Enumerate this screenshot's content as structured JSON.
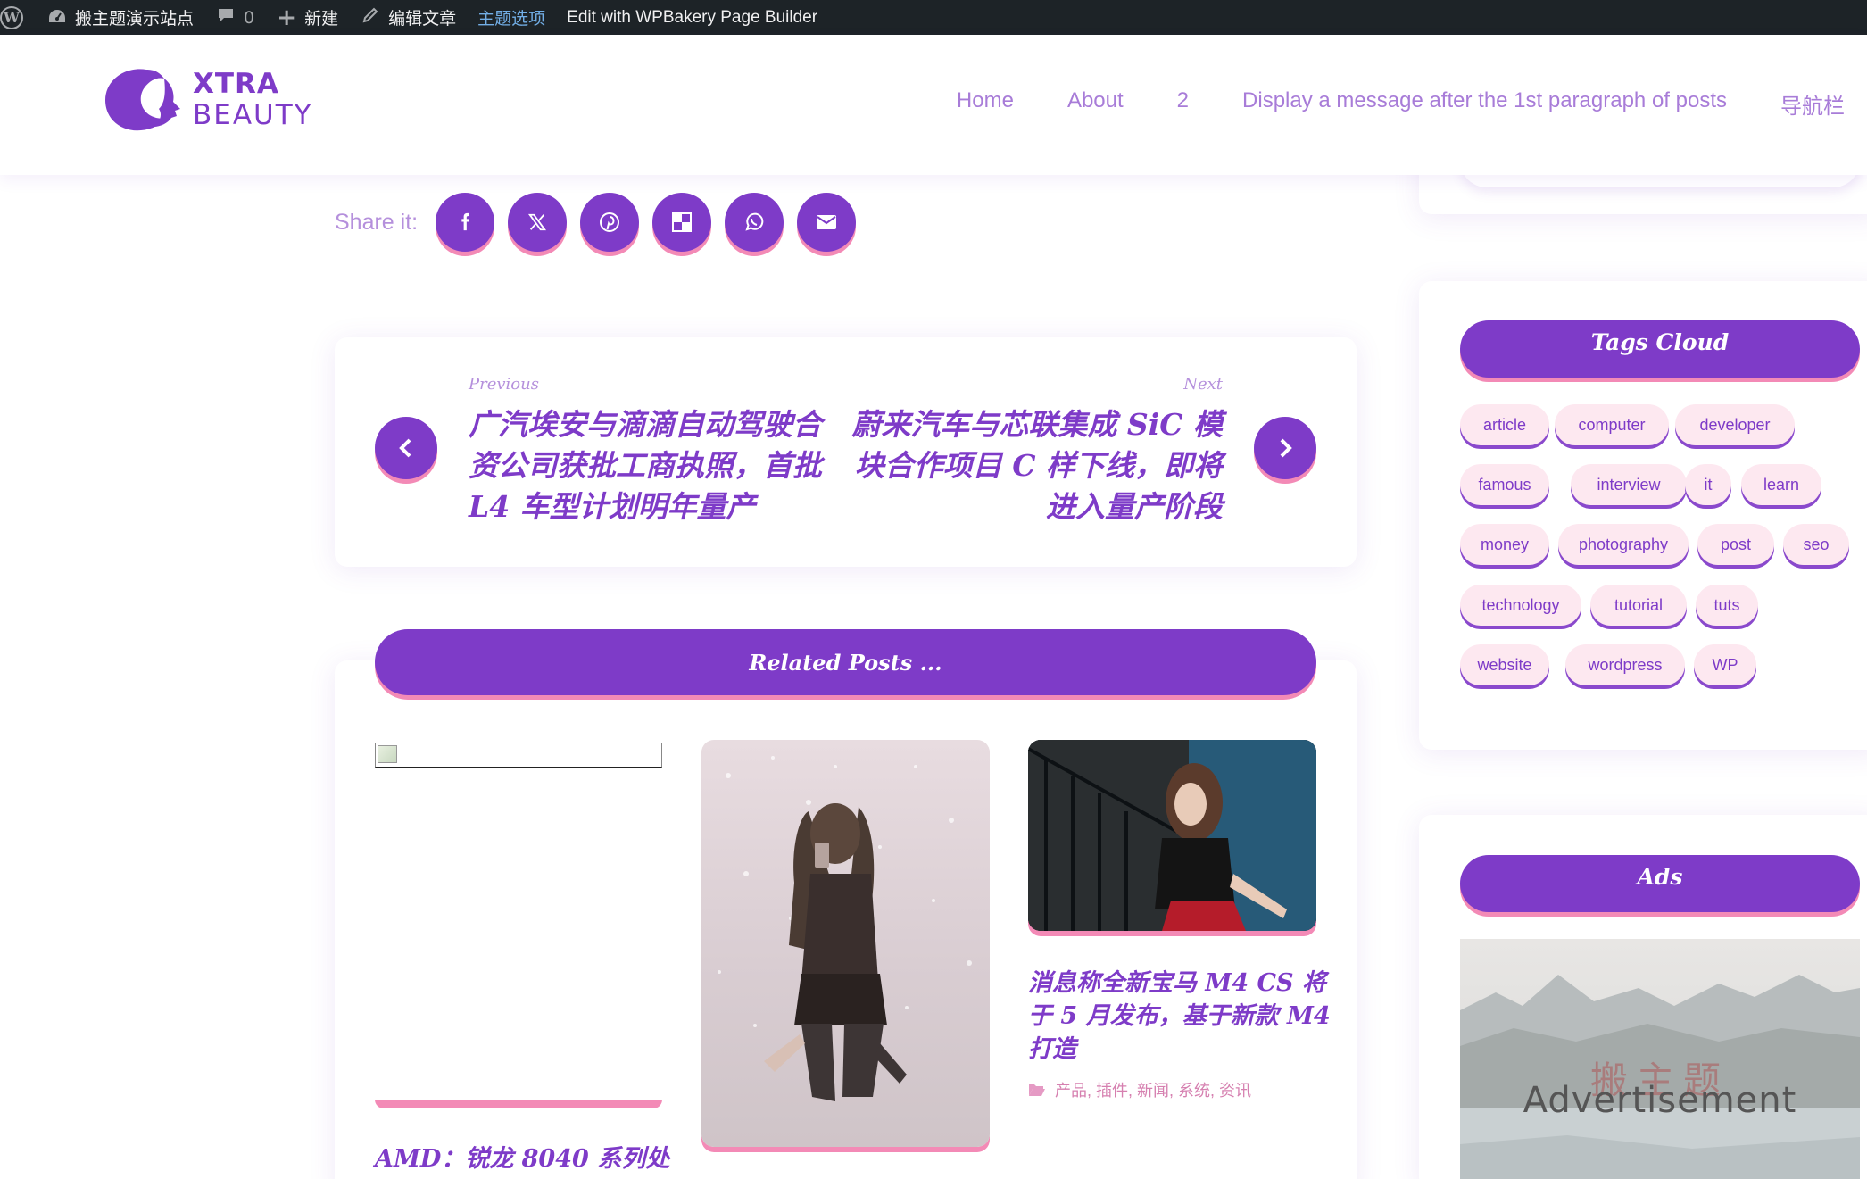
{
  "adminbar": {
    "site_name": "搬主题演示站点",
    "comments_count": "0",
    "new_label": "新建",
    "edit_label": "编辑文章",
    "theme_options_label": "主题选项",
    "wpbakery_label": "Edit with WPBakery Page Builder"
  },
  "logo": {
    "line1": "XTRA",
    "line2": "BEAUTY"
  },
  "nav": {
    "items": [
      {
        "label": "Home"
      },
      {
        "label": "About"
      },
      {
        "label": "2"
      },
      {
        "label": "Display a message after the 1st paragraph of posts"
      },
      {
        "label": "导航栏"
      }
    ]
  },
  "share": {
    "label": "Share it:",
    "buttons": [
      "facebook-icon",
      "x-icon",
      "pinterest-icon",
      "delicious-icon",
      "whatsapp-icon",
      "email-icon"
    ]
  },
  "post_nav": {
    "previous_label": "Previous",
    "previous_title_lines": [
      "广汽埃安与滴滴自动驾驶合",
      "资公司获批工商执照，首批",
      "L4 车型计划明年量产"
    ],
    "next_label": "Next",
    "next_title_lines": [
      "蔚来汽车与芯联集成 SiC 模",
      "块合作项目 C 样下线，即将",
      "进入量产阶段"
    ]
  },
  "related": {
    "header": "Related Posts ...",
    "posts": [
      {
        "title": "AMD：锐龙 8040 系列处"
      },
      {
        "title": ""
      },
      {
        "title_lines": [
          "消息称全新宝马 M4 CS 将",
          "于 5 月发布，基于新款 M4",
          "打造"
        ],
        "categories": "产品, 插件, 新闻, 系统, 资讯"
      }
    ]
  },
  "sidebar": {
    "tags_header": "Tags Cloud",
    "tags": [
      "article",
      "computer",
      "developer",
      "famous",
      "interview",
      "it",
      "learn",
      "money",
      "photography",
      "post",
      "seo",
      "technology",
      "tutorial",
      "tuts",
      "website",
      "wordpress",
      "WP"
    ],
    "ads_header": "Ads",
    "ad_text": "Advertisement",
    "ad_watermark": "搬主题"
  },
  "colors": {
    "brand_purple": "#7e3bc8",
    "accent_pink": "#f38ab6",
    "tag_bg": "#fde8f0",
    "admin_bar": "#1d2327"
  }
}
